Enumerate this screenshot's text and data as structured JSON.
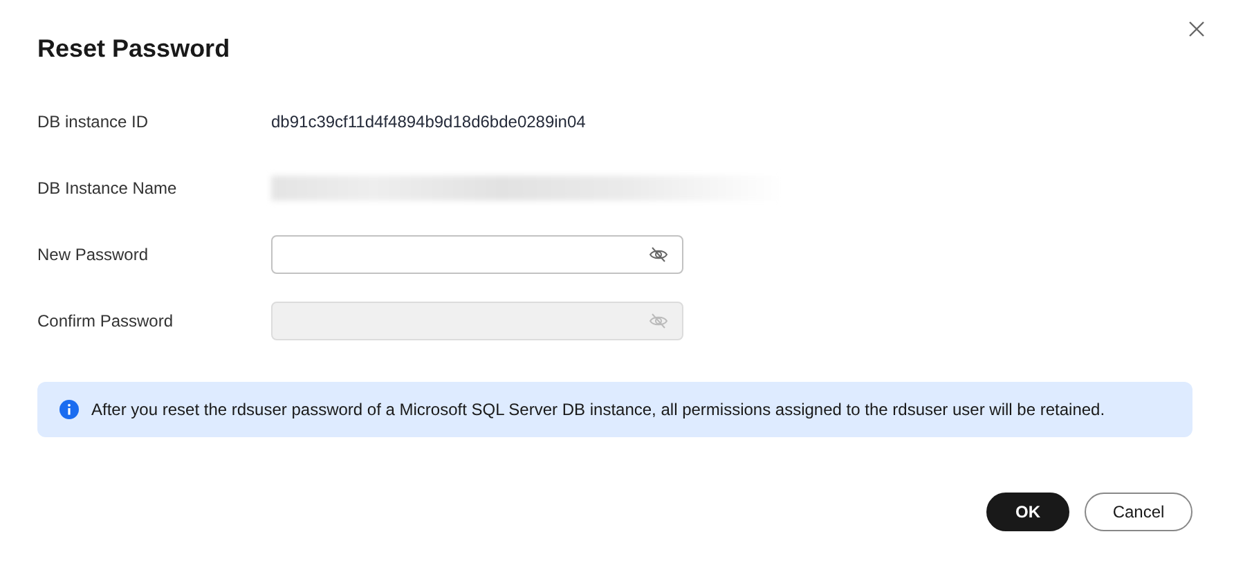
{
  "dialog": {
    "title": "Reset Password"
  },
  "rows": [
    {
      "kind": "text",
      "label": "DB instance ID",
      "value": "db91c39cf11d4f4894b9d18d6bde0289in04"
    },
    {
      "kind": "redacted",
      "label": "DB Instance Name"
    },
    {
      "kind": "password",
      "label": "New Password",
      "disabled": false
    },
    {
      "kind": "password",
      "label": "Confirm Password",
      "disabled": true
    }
  ],
  "notice": {
    "text": "After you reset the rdsuser password of a Microsoft SQL Server DB instance, all permissions assigned to the rdsuser user will be retained."
  },
  "buttons": [
    {
      "label": "OK",
      "primary": true
    },
    {
      "label": "Cancel",
      "primary": false
    }
  ]
}
